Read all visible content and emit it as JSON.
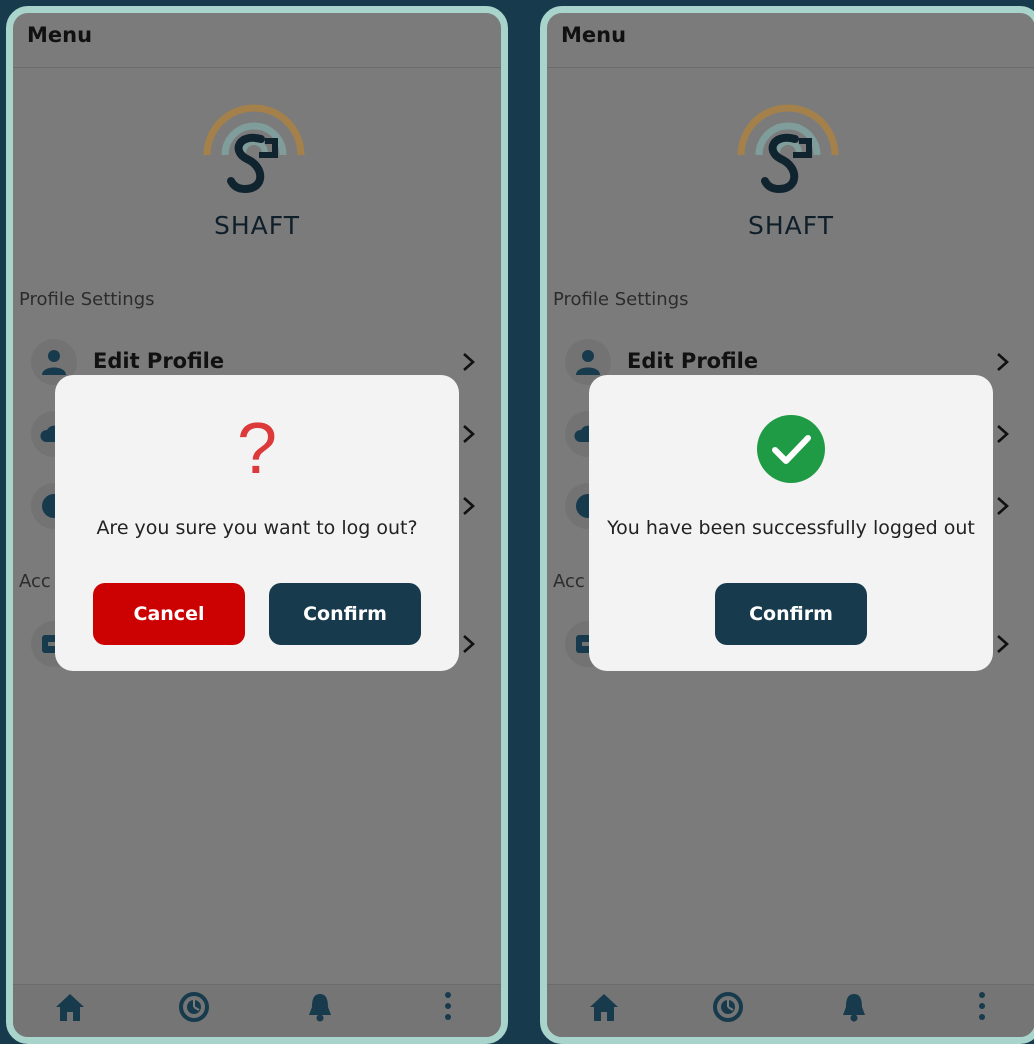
{
  "colors": {
    "accent_navy": "#173a4c",
    "danger_red": "#cc0101",
    "success_green": "#1f9b45",
    "logo_gold": "#a4814a",
    "logo_teal": "#7f9d9a",
    "question_red": "#dc3a3a"
  },
  "screens": [
    {
      "header": {
        "title": "Menu"
      },
      "brand": {
        "name": "SHAFT",
        "logo_icon": "shaft-logo-icon"
      },
      "sections": {
        "profile_label": "Profile Settings",
        "account_label": "Acc"
      },
      "rows": [
        {
          "label": "Edit Profile",
          "icon": "person-icon"
        },
        {
          "label": "",
          "icon": "cloud-icon"
        },
        {
          "label": "",
          "icon": "circle-icon"
        },
        {
          "label": "",
          "icon": "logout-icon"
        }
      ],
      "dialog": {
        "icon": "question-mark-icon",
        "glyph": "?",
        "message": "Are you sure you want to log out?",
        "cancel_label": "Cancel",
        "confirm_label": "Confirm"
      },
      "nav": [
        {
          "icon": "home-icon",
          "label": ""
        },
        {
          "icon": "history-icon",
          "label": ""
        },
        {
          "icon": "bell-icon",
          "label": ""
        },
        {
          "icon": "more-vertical-icon",
          "label": ""
        }
      ]
    },
    {
      "header": {
        "title": "Menu"
      },
      "brand": {
        "name": "SHAFT",
        "logo_icon": "shaft-logo-icon"
      },
      "sections": {
        "profile_label": "Profile Settings",
        "account_label": "Acc"
      },
      "rows": [
        {
          "label": "Edit Profile",
          "icon": "person-icon"
        },
        {
          "label": "",
          "icon": "cloud-icon"
        },
        {
          "label": "",
          "icon": "circle-icon"
        },
        {
          "label": "",
          "icon": "logout-icon"
        }
      ],
      "dialog": {
        "icon": "check-circle-icon",
        "message": "You have been successfully logged out",
        "confirm_label": "Confirm"
      },
      "nav": [
        {
          "icon": "home-icon",
          "label": ""
        },
        {
          "icon": "history-icon",
          "label": ""
        },
        {
          "icon": "bell-icon",
          "label": ""
        },
        {
          "icon": "more-vertical-icon",
          "label": ""
        }
      ]
    }
  ]
}
